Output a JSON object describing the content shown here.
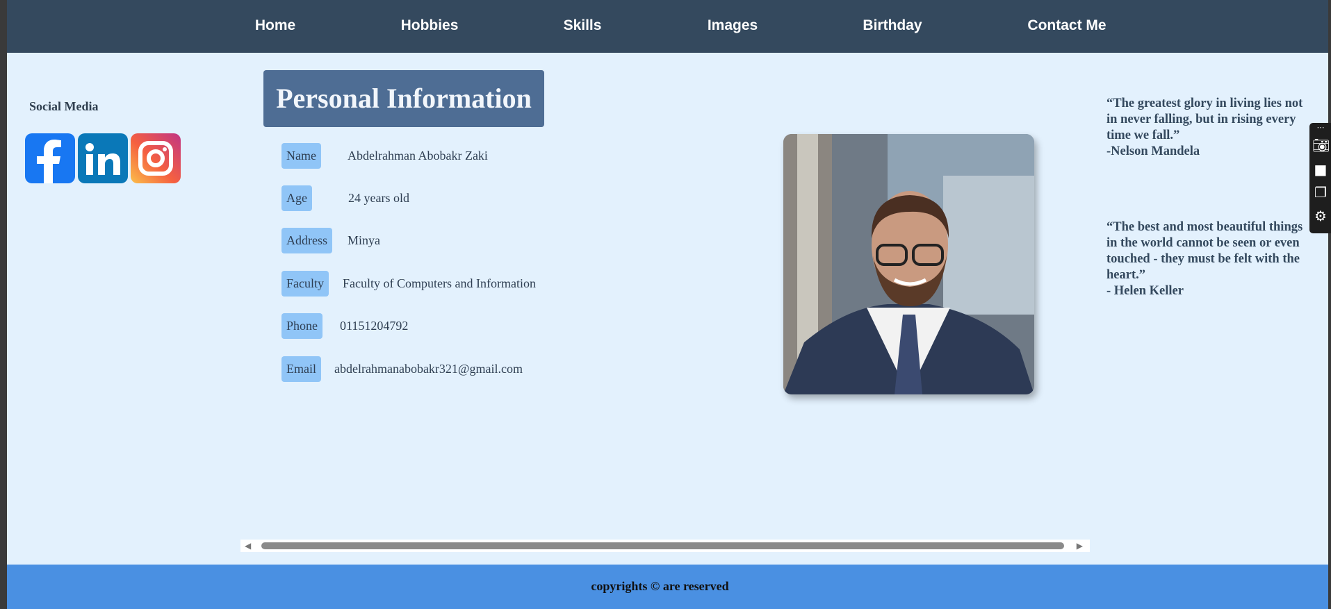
{
  "nav": {
    "items": [
      "Home",
      "Hobbies",
      "Skills",
      "Images",
      "Birthday",
      "Contact Me"
    ]
  },
  "sidebar": {
    "title": "Social Media",
    "icons": [
      "facebook-icon",
      "linkedin-icon",
      "instagram-icon"
    ]
  },
  "main": {
    "title": "Personal Information",
    "rows": [
      {
        "label": "Name",
        "value": "Abdelrahman Abobakr Zaki"
      },
      {
        "label": "Age",
        "value": "24 years old"
      },
      {
        "label": "Address",
        "value": "Minya"
      },
      {
        "label": "Faculty",
        "value": "Faculty of Computers and Information"
      },
      {
        "label": "Phone",
        "value": "01151204792"
      },
      {
        "label": "Email",
        "value": "abdelrahmanabobakr321@gmail.com"
      }
    ]
  },
  "quotes": [
    {
      "text": "“The greatest glory in living lies not in never falling, but in rising every time we fall.”",
      "author": "-Nelson Mandela"
    },
    {
      "text": "“The best and most beautiful things in the world cannot be seen or even touched - they must be felt with the heart.”",
      "author": "- Helen Keller"
    }
  ],
  "footer": {
    "text": "copyrights © are reserved"
  },
  "colors": {
    "nav": "#34495e",
    "background": "#e3f1fd",
    "title": "#4e6d94",
    "label": "#90c5f7",
    "footer": "#4a90e2"
  }
}
